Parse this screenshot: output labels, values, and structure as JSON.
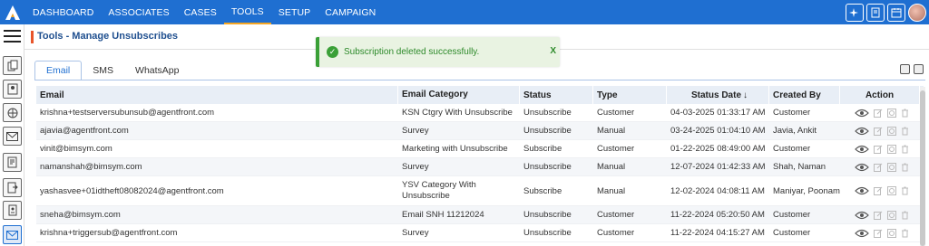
{
  "nav": {
    "items": [
      "DASHBOARD",
      "ASSOCIATES",
      "CASES",
      "TOOLS",
      "SETUP",
      "CAMPAIGN"
    ],
    "active": "TOOLS",
    "right_icons": [
      "sparkle-icon",
      "document-check-icon",
      "calendar-icon"
    ]
  },
  "page": {
    "title": "Tools - Manage Unsubscribes"
  },
  "toast": {
    "message": "Subscription deleted successfully.",
    "close": "X",
    "color": "#3aa037"
  },
  "tabs": [
    "Email",
    "SMS",
    "WhatsApp"
  ],
  "table": {
    "headers": {
      "email": "Email",
      "category": "Email Category",
      "status": "Status",
      "type": "Type",
      "date": "Status Date",
      "sort_arrow": "↓",
      "created_by": "Created By",
      "action": "Action"
    },
    "rows": [
      {
        "email": "krishna+testserversubunsub@agentfront.com",
        "category": "KSN Ctgry With Unsubscribe",
        "status": "Unsubscribe",
        "type": "Customer",
        "date": "04-03-2025 01:33:17 AM",
        "created_by": "Customer"
      },
      {
        "email": "ajavia@agentfront.com",
        "category": "Survey",
        "status": "Unsubscribe",
        "type": "Manual",
        "date": "03-24-2025 01:04:10 AM",
        "created_by": "Javia, Ankit"
      },
      {
        "email": "vinit@bimsym.com",
        "category": "Marketing with Unsubscribe",
        "status": "Subscribe",
        "type": "Customer",
        "date": "01-22-2025 08:49:00 AM",
        "created_by": "Customer"
      },
      {
        "email": "namanshah@bimsym.com",
        "category": "Survey",
        "status": "Unsubscribe",
        "type": "Manual",
        "date": "12-07-2024 01:42:33 AM",
        "created_by": "Shah, Naman"
      },
      {
        "email": "yashasvee+01idtheft08082024@agentfront.com",
        "category": "YSV Category With Unsubscribe",
        "status": "Subscribe",
        "type": "Manual",
        "date": "12-02-2024 04:08:11 AM",
        "created_by": "Maniyar, Poonam"
      },
      {
        "email": "sneha@bimsym.com",
        "category": "Email SNH 11212024",
        "status": "Unsubscribe",
        "type": "Customer",
        "date": "11-22-2024 05:20:50 AM",
        "created_by": "Customer"
      },
      {
        "email": "krishna+triggersub@agentfront.com",
        "category": "Survey",
        "status": "Unsubscribe",
        "type": "Customer",
        "date": "11-22-2024 04:15:27 AM",
        "created_by": "Customer"
      }
    ],
    "row_actions": [
      "eye-icon",
      "edit-icon",
      "history-icon",
      "trash-icon"
    ]
  },
  "colors": {
    "nav_bg": "#1f6fd1",
    "accent": "#e8552b",
    "header_bg": "#e8eef6"
  }
}
